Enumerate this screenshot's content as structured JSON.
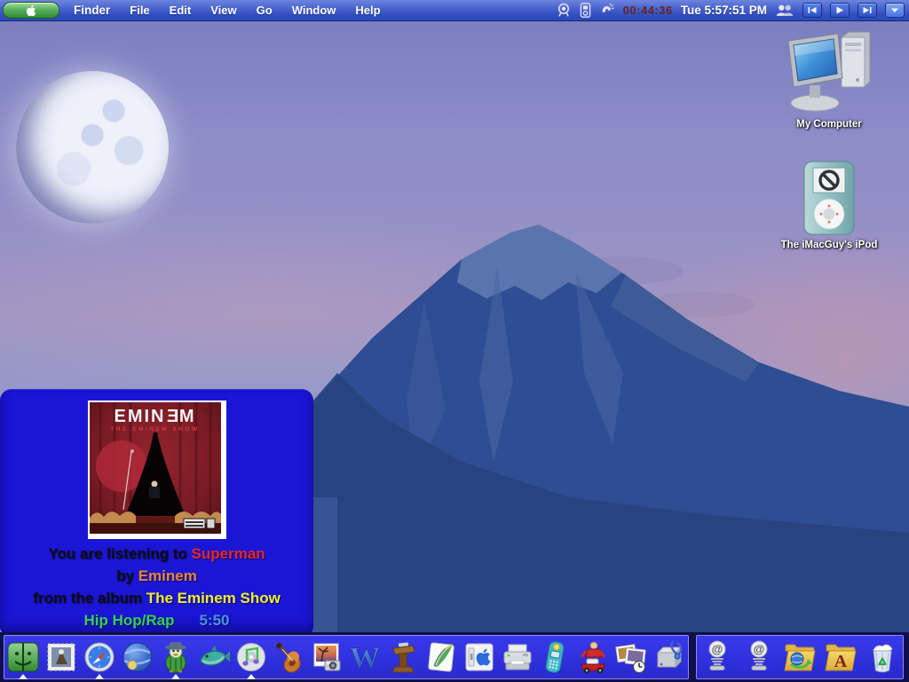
{
  "menubar": {
    "menus": [
      "Finder",
      "File",
      "Edit",
      "View",
      "Go",
      "Window",
      "Help"
    ],
    "active_app": "Finder",
    "status": {
      "timer": "00:44:36",
      "clock": "Tue 5:57:51 PM"
    },
    "status_icons": [
      "video-camera-icon",
      "ipod-status-icon",
      "phone-status-icon",
      "fast-user-switching-icon"
    ],
    "media_buttons": [
      "previous-track",
      "play",
      "next-track",
      "itunes-menu-dropdown"
    ],
    "colors": {
      "bar": "#3350c2",
      "apple_pill": "#2f8a36",
      "timer_text": "#6b2121"
    }
  },
  "desktop": {
    "icons": [
      {
        "label": "My Computer",
        "icon": "computer-icon"
      },
      {
        "label": "The iMacGuy's iPod",
        "icon": "ipod-icon"
      }
    ]
  },
  "now_playing": {
    "line1_prefix": "You are listening to ",
    "track": "Superman",
    "line2_prefix": "by ",
    "artist": "Eminem",
    "line3_prefix": "from the album ",
    "album": "The Eminem Show",
    "genre": "Hip Hop/Rap",
    "duration": "5:50",
    "album_art_artist_parts": [
      "EMIN",
      "E",
      "M"
    ],
    "album_art_title": "THE EMINEM SHOW",
    "colors": {
      "panel": "#1b15d6",
      "track": "#e82525",
      "artist": "#e8872c",
      "album": "#eef02e",
      "genre": "#2ed455",
      "duration": "#4a93e0"
    }
  },
  "dock": {
    "left_items": [
      {
        "name": "finder",
        "running": true
      },
      {
        "name": "mail",
        "running": false
      },
      {
        "name": "safari",
        "running": true
      },
      {
        "name": "internet-globe",
        "running": false
      },
      {
        "name": "duck-character",
        "running": true
      },
      {
        "name": "fish-character",
        "running": false
      },
      {
        "name": "itunes",
        "running": true
      },
      {
        "name": "garageband",
        "running": false
      },
      {
        "name": "iphoto",
        "running": false
      },
      {
        "name": "microsoft-word",
        "running": false
      },
      {
        "name": "podium",
        "running": false
      },
      {
        "name": "appleworks",
        "running": false
      },
      {
        "name": "apple-switch-box",
        "running": false
      },
      {
        "name": "printer",
        "running": false
      },
      {
        "name": "mobile-phone",
        "running": false
      },
      {
        "name": "toy-racer",
        "running": false
      },
      {
        "name": "photo-stack",
        "running": false
      },
      {
        "name": "disk-doctor",
        "running": false
      }
    ],
    "right_items": [
      {
        "name": "web-shortcut-1",
        "running": false
      },
      {
        "name": "web-shortcut-2",
        "running": false
      },
      {
        "name": "sites-folder",
        "running": false
      },
      {
        "name": "applications-folder",
        "running": false
      },
      {
        "name": "trash",
        "running": false
      }
    ]
  }
}
